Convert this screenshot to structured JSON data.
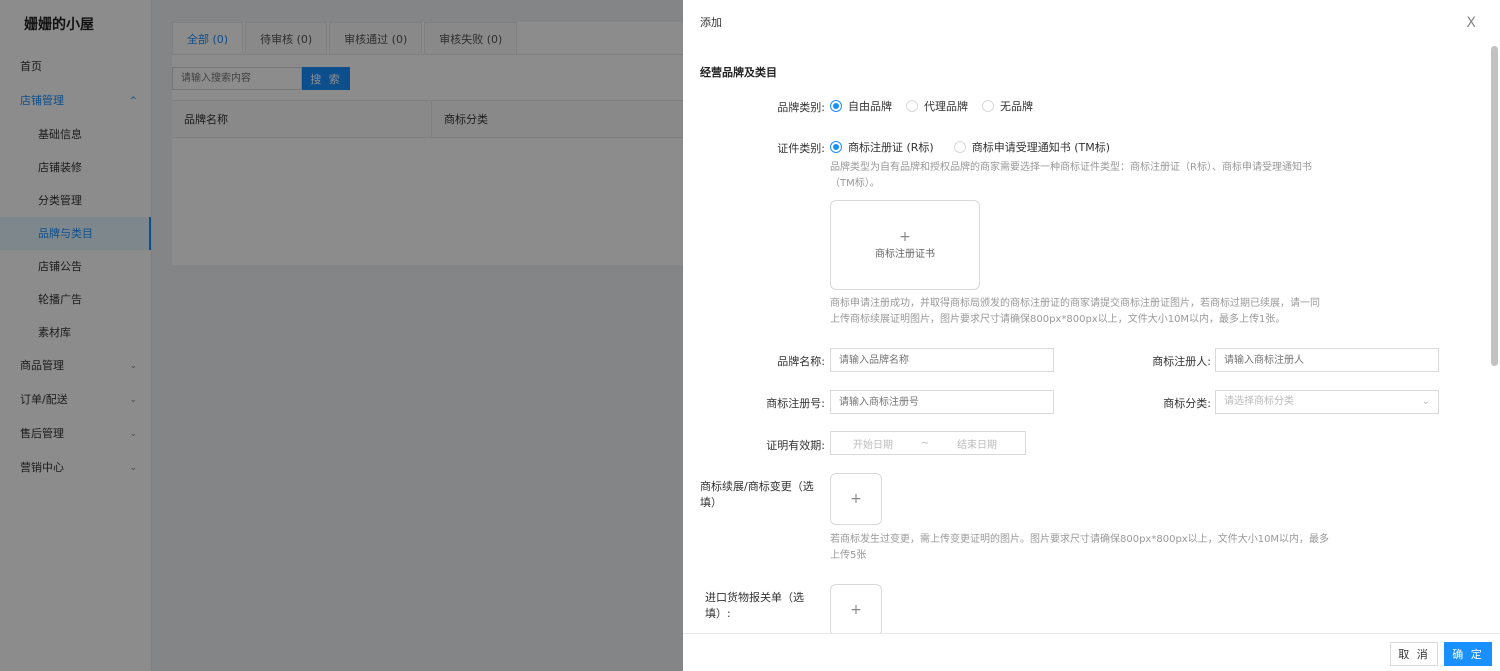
{
  "sidebar": {
    "brand": "姗姗的小屋",
    "items": [
      {
        "label": "首页"
      },
      {
        "label": "店铺管理",
        "chevron": "^"
      },
      {
        "label": "基础信息"
      },
      {
        "label": "店铺装修"
      },
      {
        "label": "分类管理"
      },
      {
        "label": "品牌与类目"
      },
      {
        "label": "店铺公告"
      },
      {
        "label": "轮播广告"
      },
      {
        "label": "素材库"
      },
      {
        "label": "商品管理",
        "chevron": "⌄"
      },
      {
        "label": "订单/配送",
        "chevron": "⌄"
      },
      {
        "label": "售后管理",
        "chevron": "⌄"
      },
      {
        "label": "营销中心",
        "chevron": "⌄"
      }
    ]
  },
  "main": {
    "tabs": [
      {
        "label": "全部 (0)"
      },
      {
        "label": "待审核 (0)"
      },
      {
        "label": "审核通过 (0)"
      },
      {
        "label": "审核失败 (0)"
      }
    ],
    "search_placeholder": "请输入搜索内容",
    "search_button": "搜 索",
    "columns": [
      "品牌名称",
      "商标分类"
    ]
  },
  "drawer": {
    "title": "添加",
    "close": "X",
    "section_title": "经营品牌及类目",
    "brand_type_label": "品牌类别:",
    "brand_type_options": [
      "自由品牌",
      "代理品牌",
      "无品牌"
    ],
    "cert_type_label": "证件类别:",
    "cert_type_options": [
      "商标注册证 (R标)",
      "商标申请受理通知书 (TM标)"
    ],
    "cert_hint_1": "品牌类型为自有品牌和授权品牌的商家需要选择一种商标证件类型：商标注册证（R标）、商标申请受理通知书",
    "cert_hint_2": "（TM标）。",
    "upload_plus": "+",
    "upload_cert_text": "商标注册证书",
    "upload_hint_1": "商标申请注册成功，并取得商标局颁发的商标注册证的商家请提交商标注册证图片，若商标过期已续展，请一同",
    "upload_hint_2": "上传商标续展证明图片，图片要求尺寸请确保800px*800px以上，文件大小10M以内，最多上传1张。",
    "brand_name_label": "品牌名称:",
    "brand_name_placeholder": "请输入品牌名称",
    "registrant_label": "商标注册人:",
    "registrant_placeholder": "请输入商标注册人",
    "reg_no_label": "商标注册号:",
    "reg_no_placeholder": "请输入商标注册号",
    "category_label": "商标分类:",
    "category_placeholder": "请选择商标分类",
    "category_arrow": "⌄",
    "validity_label": "证明有效期:",
    "start_date": "开始日期",
    "date_sep": "~",
    "end_date": "结束日期",
    "renewal_label": "商标续展/商标变更（选填）",
    "renewal_hint_1": "若商标发生过变更，需上传变更证明的图片。图片要求尺寸请确保800px*800px以上，文件大小10M以内，最多",
    "renewal_hint_2": "上传5张",
    "import_label": "进口货物报关单（选填）:",
    "cancel": "取 消",
    "ok": "确 定"
  }
}
